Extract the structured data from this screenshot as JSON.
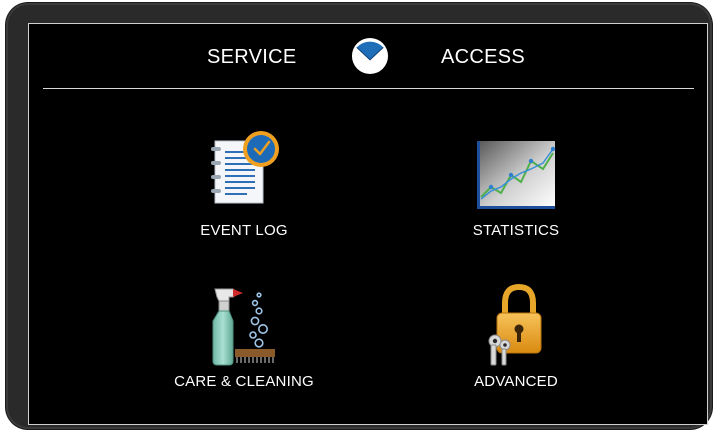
{
  "header": {
    "service_label": "SERVICE",
    "access_label": "ACCESS"
  },
  "tiles": [
    {
      "label": "EVENT LOG",
      "icon": "event-log-icon"
    },
    {
      "label": "STATISTICS",
      "icon": "statistics-chart-icon"
    },
    {
      "label": "CARE & CLEANING",
      "icon": "spray-bottle-brush-icon"
    },
    {
      "label": "ADVANCED",
      "icon": "padlock-keys-icon"
    }
  ],
  "colors": {
    "background": "#000000",
    "text": "#ffffff",
    "accent_blue": "#1e6fb8",
    "clock_orange": "#f0a020",
    "lock_gold": "#e39a1c"
  }
}
